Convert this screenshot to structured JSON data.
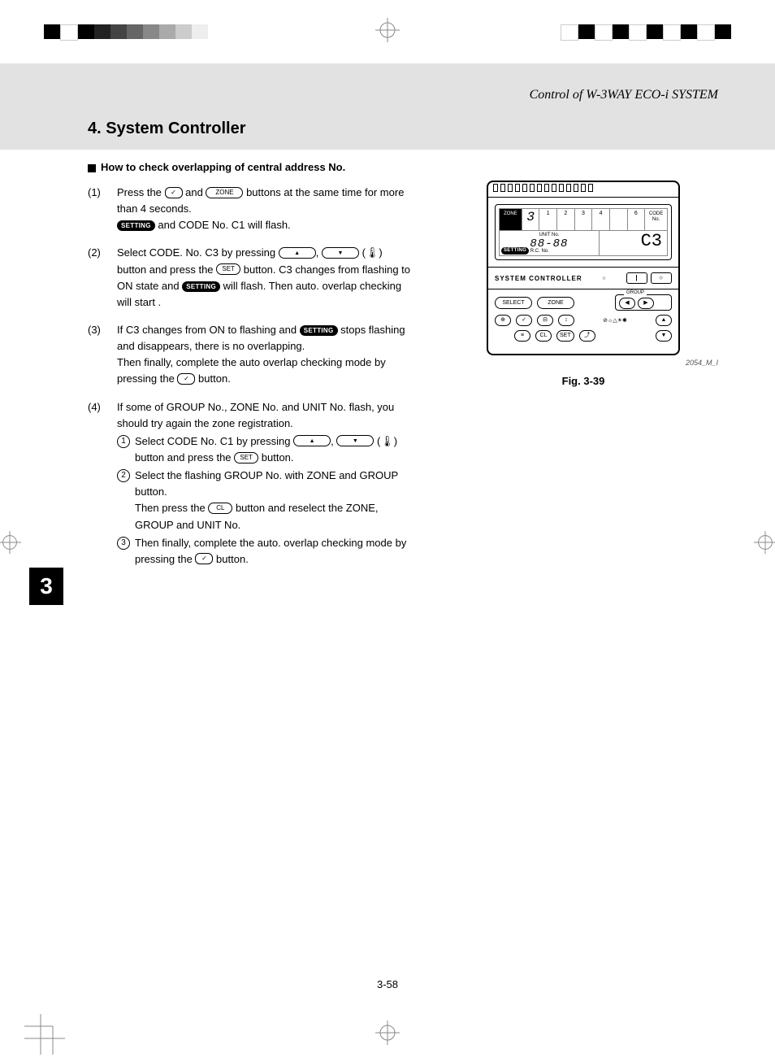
{
  "running_head": "Control of W-3WAY ECO-i SYSTEM",
  "section_title": "4. System Controller",
  "sub_heading": "How to check overlapping of central address No.",
  "chapter_tab": "3",
  "page_number": "3-58",
  "steps": {
    "s1": {
      "num": "(1)",
      "t1": "Press the ",
      "t2": " and ",
      "btn_zone": "ZONE",
      "t3": " buttons at the same time for more than 4 seconds.",
      "t4": " and CODE No. C1 will flash.",
      "badge": "SETTING"
    },
    "s2": {
      "num": "(2)",
      "t1": "Select CODE. No. C3 by pressing ",
      "t2": ",",
      "t3": " (",
      "t4": ") button and press the ",
      "btn_set": "SET",
      "t5": " button.",
      "t6": "C3 changes from flashing to ON state and ",
      "badge": "SETTING",
      "t7": " will flash. Then auto. overlap checking will start ."
    },
    "s3": {
      "num": "(3)",
      "t1": "If C3 changes from ON to flashing and ",
      "badge": "SETTING",
      "t2": " stops flashing and disappears, there is no overlapping.",
      "t3": "Then finally, complete the auto overlap checking mode by pressing the ",
      "t4": " button."
    },
    "s4": {
      "num": "(4)",
      "t1": "If some of GROUP No., ZONE No. and UNIT No. flash, you should try again the zone registration.",
      "sub1": {
        "n": "1",
        "t1": "Select CODE No. C1 by pressing ",
        "t2": ",",
        "t3": " (",
        "t4": ") button and press the ",
        "btn_set": "SET",
        "t5": " button."
      },
      "sub2": {
        "n": "2",
        "t1": "Select the flashing GROUP No. with ZONE and GROUP button.",
        "t2": "Then press the ",
        "btn_cl": "CL",
        "t3": " button and reselect the ZONE, GROUP and UNIT No."
      },
      "sub3": {
        "n": "3",
        "t1": "Then finally, complete the auto. overlap checking mode by pressing the ",
        "t2": " button."
      }
    }
  },
  "figure": {
    "caption": "Fig. 3-39",
    "code": "2054_M_I",
    "controller_label": "SYSTEM CONTROLLER",
    "display": {
      "zone_label": "ZONE",
      "zone_val": "3",
      "cells": [
        "1",
        "2",
        "3",
        "4",
        "",
        "6"
      ],
      "code_label": "CODE No.",
      "unit_label": "UNIT No.",
      "unit_val": "88-88",
      "setting_badge": "SETTING",
      "rc_label": "R.C.   No.",
      "code_val": "C3"
    },
    "power": {
      "on": "|",
      "off": "○",
      "dot": "○"
    },
    "buttons": {
      "select": "SELECT",
      "zone": "ZONE",
      "group_label": "GROUP",
      "left": "◀",
      "right": "▶",
      "up": "▲",
      "down": "▼",
      "cl": "CL",
      "set": "SET",
      "timer_icon": "≡"
    }
  }
}
